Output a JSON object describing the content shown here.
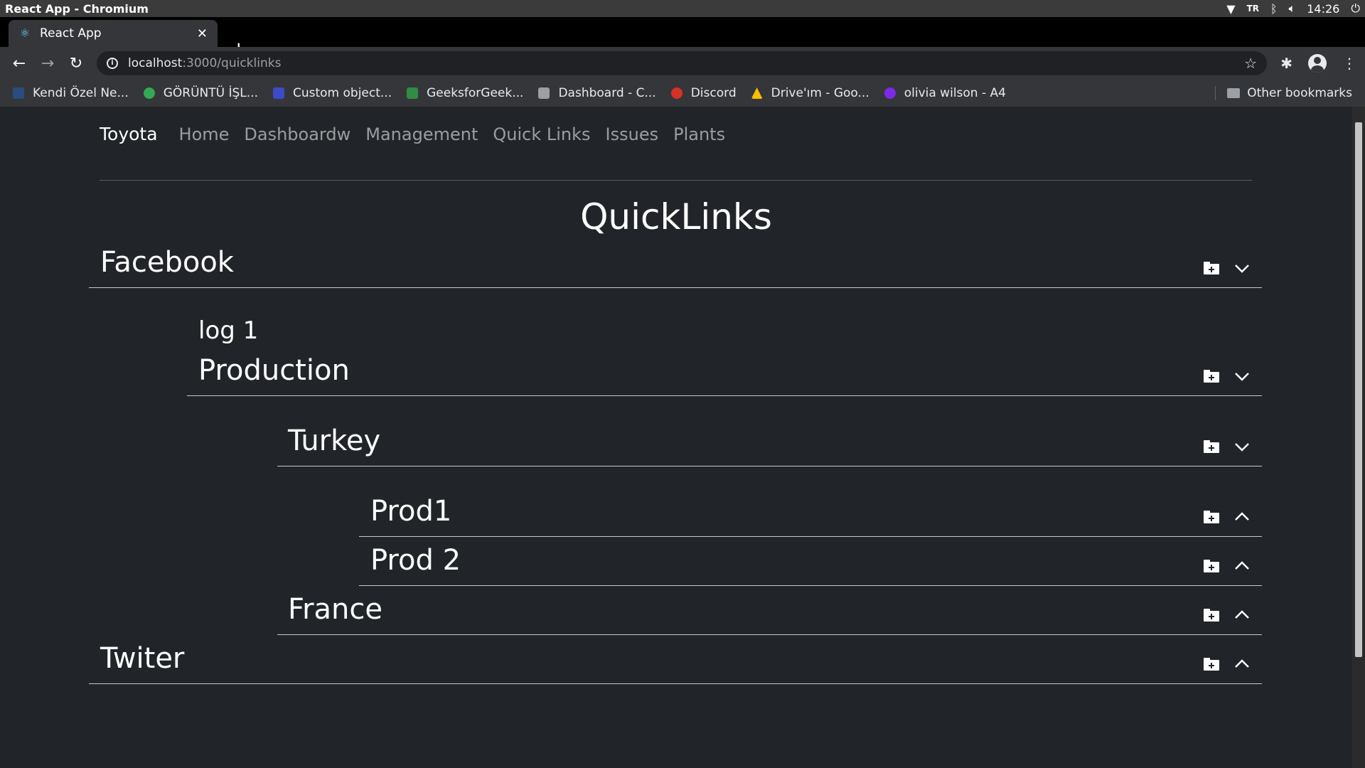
{
  "os": {
    "window_title": "React App - Chromium",
    "lang": "TR",
    "clock": "14:26"
  },
  "browser": {
    "tab_title": "React App",
    "url_host": "localhost",
    "url_path": ":3000/quicklinks",
    "bookmarks": [
      {
        "label": "Kendi Özel Ne...",
        "color": "#2b4c7e"
      },
      {
        "label": "GÖRÜNTÜ İŞL...",
        "color": "#34a853"
      },
      {
        "label": "Custom object...",
        "color": "#3c4bc8"
      },
      {
        "label": "GeeksforGeek...",
        "color": "#2f8d46"
      },
      {
        "label": "Dashboard - C...",
        "color": "#9aa0a6"
      },
      {
        "label": "Discord",
        "color": "#d93025"
      },
      {
        "label": "Drive'ım - Goo...",
        "color": "#fbbc04"
      },
      {
        "label": "olivia wilson - A4",
        "color": "#7d2ae8"
      }
    ],
    "other_bookmarks": "Other bookmarks"
  },
  "app": {
    "brand": "Toyota",
    "nav": [
      "Home",
      "Dashboardw",
      "Management",
      "Quick Links",
      "Issues",
      "Plants"
    ],
    "page_title": "QuickLinks",
    "tree": {
      "facebook": {
        "label": "Facebook",
        "expanded": true
      },
      "log1": {
        "label": "log 1"
      },
      "production": {
        "label": "Production",
        "expanded": true
      },
      "turkey": {
        "label": "Turkey",
        "expanded": true
      },
      "prod1": {
        "label": "Prod1",
        "expanded": false
      },
      "prod2": {
        "label": "Prod 2",
        "expanded": false
      },
      "france": {
        "label": "France",
        "expanded": false
      },
      "twiter": {
        "label": "Twiter",
        "expanded": false
      }
    }
  }
}
